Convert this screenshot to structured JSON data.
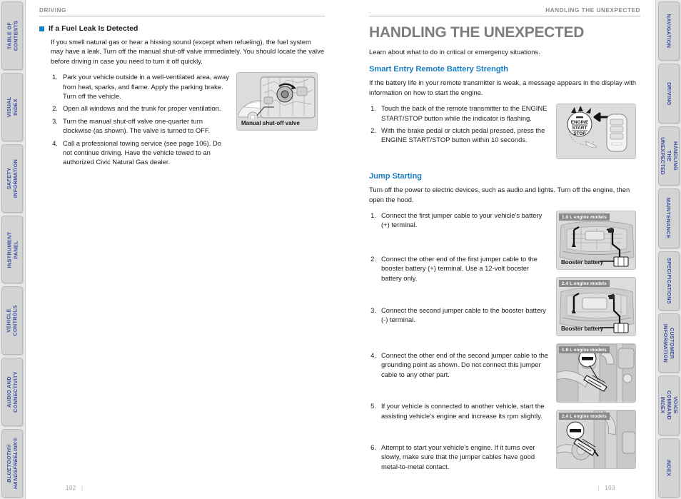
{
  "left_tabs": [
    {
      "label": "TABLE OF CONTENTS",
      "italic": false
    },
    {
      "label": "VISUAL INDEX",
      "italic": false
    },
    {
      "label": "SAFETY INFORMATION",
      "italic": false
    },
    {
      "label": "INSTRUMENT PANEL",
      "italic": false
    },
    {
      "label": "VEHICLE\nCONTROLS",
      "italic": false
    },
    {
      "label": "AUDIO AND\nCONNECTIVITY",
      "italic": false
    },
    {
      "label": "BLUETOOTH®\nHANDSFREELINK®",
      "italic": true
    }
  ],
  "right_tabs": [
    {
      "label": "NAVIGATION"
    },
    {
      "label": "DRIVING"
    },
    {
      "label": "HANDLING THE\nUNEXPECTED"
    },
    {
      "label": "MAINTENANCE"
    },
    {
      "label": "SPECIFICATIONS"
    },
    {
      "label": "CUSTOMER\nINFORMATION"
    },
    {
      "label": "VOICE COMMAND\nINDEX"
    },
    {
      "label": "INDEX"
    }
  ],
  "left_page": {
    "running_head": "DRIVING",
    "section_heading": "If a Fuel Leak Is Detected",
    "intro": "If you smell natural gas or hear a hissing sound (except when refueling), the fuel system may have a leak. Turn off the manual shut-off valve immediately. You should locate the valve before driving in case you need to turn it off quickly.",
    "steps": [
      {
        "num": "1.",
        "text": "Park your vehicle outside in a well-ventilated area, away from heat, sparks, and flame. Apply the parking brake. Turn off the vehicle."
      },
      {
        "num": "2.",
        "text": "Open all windows and the trunk for proper ventilation."
      },
      {
        "num": "3.",
        "text": "Turn the manual shut-off valve one-quarter turn clockwise (as shown). The valve is turned to OFF."
      },
      {
        "num": "4.",
        "text": "Call a professional towing service (see page 106). Do not continue driving. Have the vehicle towed to an authorized Civic Natural Gas dealer."
      }
    ],
    "figure": {
      "caption": "Manual shut-off valve"
    },
    "folio": "102"
  },
  "right_page": {
    "running_head": "HANDLING THE UNEXPECTED",
    "chapter_title": "HANDLING THE UNEXPECTED",
    "intro": "Learn about what to do in critical or emergency situations.",
    "section1": {
      "heading": "Smart Entry Remote Battery Strength",
      "body": "If the battery life in your remote transmitter is weak, a message appears in the display with information on how to start the engine.",
      "steps": [
        {
          "num": "1.",
          "text": "Touch the back of the remote transmitter to the ENGINE START/STOP button while the indicator is flashing."
        },
        {
          "num": "2.",
          "text": "With the brake pedal or clutch pedal pressed, press the ENGINE START/STOP button within 10 seconds."
        }
      ],
      "figure_button_label": "ENGINE\nSTART\nSTOP"
    },
    "section2": {
      "heading": "Jump Starting",
      "body": "Turn off the power to electric devices, such as audio and lights. Turn off the engine, then open the hood.",
      "steps": [
        {
          "num": "1.",
          "text": "Connect the first jumper cable to your vehicle's battery (+) terminal."
        },
        {
          "num": "2.",
          "text": "Connect the other end of the first jumper cable to the booster battery (+) terminal. Use a 12-volt booster battery only."
        },
        {
          "num": "3.",
          "text": "Connect the second jumper cable to the booster battery (-) terminal."
        },
        {
          "num": "4.",
          "text": "Connect the other end of the second jumper cable to the grounding point as shown. Do not connect this jumper cable to any other part."
        },
        {
          "num": "5.",
          "text": "If your vehicle is connected to another vehicle, start the assisting vehicle's engine and increase its rpm slightly."
        },
        {
          "num": "6.",
          "text": "Attempt to start your vehicle's engine. If it turns over slowly, make sure that the jumper cables have good metal-to-metal contact."
        }
      ],
      "figures": [
        {
          "tag": "1.8 L engine models",
          "caption": "Booster battery"
        },
        {
          "tag": "2.4 L engine models",
          "caption": "Booster battery"
        },
        {
          "tag": "1.8 L engine models",
          "caption": ""
        },
        {
          "tag": "2.4 L engine models",
          "caption": ""
        }
      ]
    },
    "folio": "103"
  },
  "colors": {
    "accent_blue": "#1a7fc4",
    "tab_text": "#3b4ea0",
    "chapter_gray": "#7d7d7d"
  }
}
